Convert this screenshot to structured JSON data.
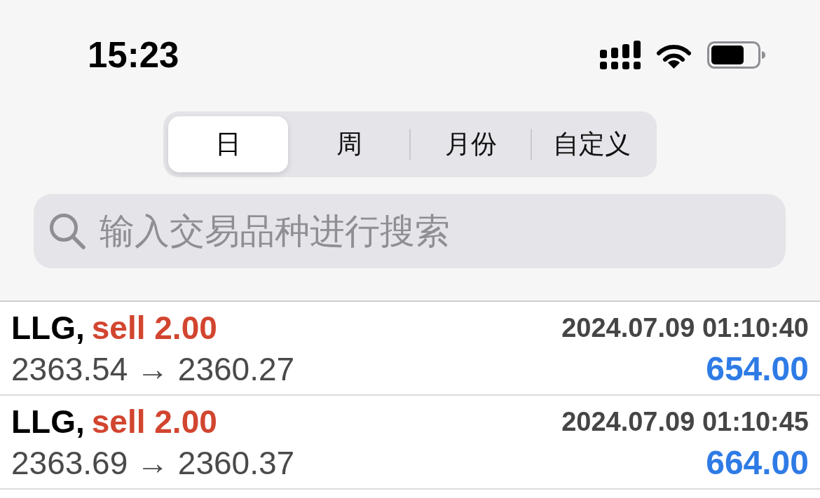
{
  "status_bar": {
    "time": "15:23"
  },
  "period_tabs": [
    {
      "label": "日",
      "selected": true
    },
    {
      "label": "周",
      "selected": false
    },
    {
      "label": "月份",
      "selected": false
    },
    {
      "label": "自定义",
      "selected": false
    }
  ],
  "search": {
    "placeholder": "输入交易品种进行搜索"
  },
  "trades": [
    {
      "symbol": "LLG,",
      "order": "sell 2.00",
      "time": "2024.07.09 01:10:40",
      "prices": "2363.54 → 2360.27",
      "profit": "654.00"
    },
    {
      "symbol": "LLG,",
      "order": "sell 2.00",
      "time": "2024.07.09 01:10:45",
      "prices": "2363.69 → 2360.37",
      "profit": "664.00"
    }
  ]
}
